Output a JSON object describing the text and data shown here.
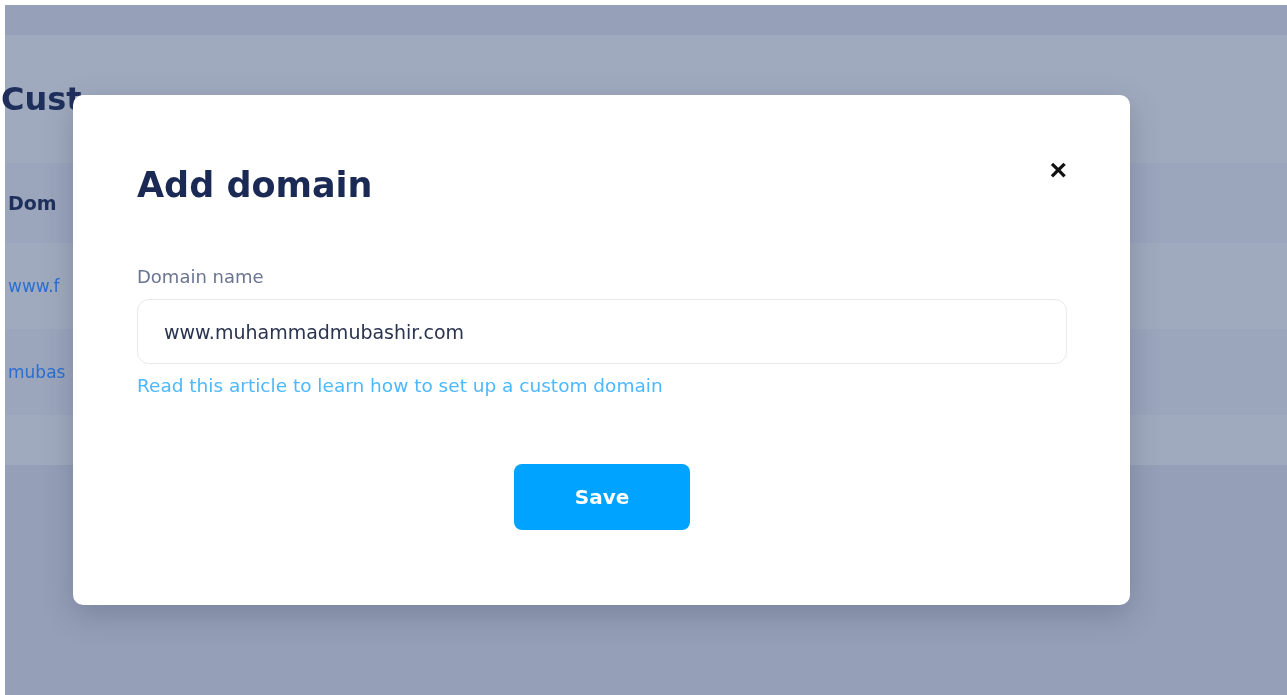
{
  "page": {
    "heading": "Cust",
    "table": {
      "header": "Dom",
      "rows": [
        "www.f",
        "mubas"
      ]
    }
  },
  "dialog": {
    "title": "Add domain",
    "close": "×",
    "field": {
      "label": "Domain name",
      "value": "www.muhammadmubashir.com"
    },
    "help_link": "Read this article to learn how to set up a custom domain",
    "button": "Save"
  }
}
